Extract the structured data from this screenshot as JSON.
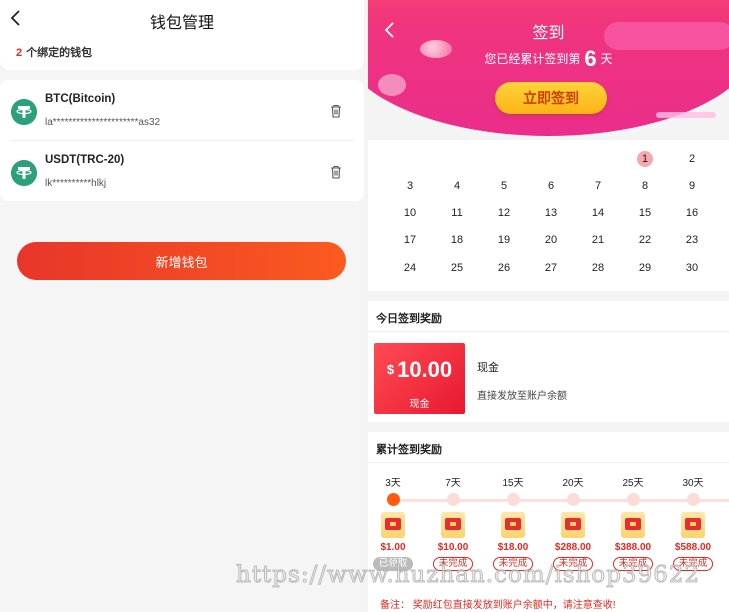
{
  "left": {
    "title": "钱包管理",
    "count": "2",
    "count_label": "个绑定的钱包",
    "wallets": [
      {
        "name": "BTC(Bitcoin)",
        "address": "la**********************as32"
      },
      {
        "name": "USDT(TRC-20)",
        "address": "lk**********hlkj"
      }
    ],
    "add_button": "新增钱包"
  },
  "right": {
    "title": "签到",
    "subtitle_pre": "您已经累计签到第",
    "days": "6",
    "subtitle_post": "天",
    "sign_button": "立即签到",
    "calendar": [
      "1",
      "2",
      "3",
      "4",
      "5",
      "6",
      "7",
      "8",
      "9",
      "10",
      "11",
      "12",
      "13",
      "14",
      "15",
      "16",
      "17",
      "18",
      "19",
      "20",
      "21",
      "22",
      "23",
      "24",
      "25",
      "26",
      "27",
      "28",
      "29",
      "30"
    ],
    "today": "1",
    "today_reward": {
      "title": "今日签到奖励",
      "currency": "$",
      "amount": "10.00",
      "card_label": "现金",
      "type": "现金",
      "desc": "直接发放至账户余额"
    },
    "cumulative": {
      "title": "累计签到奖励",
      "milestones": [
        {
          "day": "3天",
          "amount": "$1.00",
          "status": "已领取",
          "done": true
        },
        {
          "day": "7天",
          "amount": "$10.00",
          "status": "未完成",
          "done": false
        },
        {
          "day": "15天",
          "amount": "$18.00",
          "status": "未完成",
          "done": false
        },
        {
          "day": "20天",
          "amount": "$288.00",
          "status": "未完成",
          "done": false
        },
        {
          "day": "25天",
          "amount": "$388.00",
          "status": "未完成",
          "done": false
        },
        {
          "day": "30天",
          "amount": "$588.00",
          "status": "未完成",
          "done": false
        }
      ]
    },
    "note": "备注：  奖励红包直接发放到账户余额中，请注意查收!"
  },
  "watermark": "https://www.huzhan.com/ishop39622",
  "colors": {
    "accent": "#e8281f",
    "tether_green": "#2ca07a",
    "sign_button": "#fbb316"
  }
}
